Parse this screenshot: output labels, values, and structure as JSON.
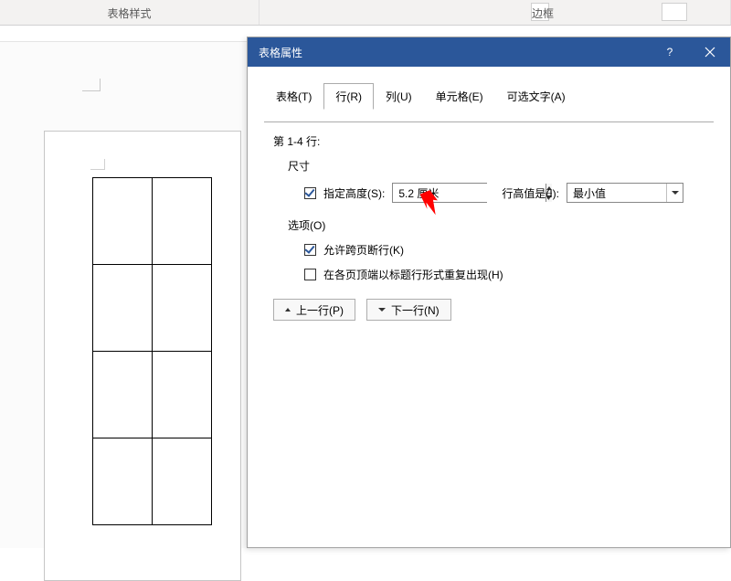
{
  "ribbon": {
    "group_table_styles": "表格样式",
    "group_borders": "边框"
  },
  "dialog": {
    "title": "表格属性",
    "tabs": {
      "table": "表格(T)",
      "row": "行(R)",
      "column": "列(U)",
      "cell": "单元格(E)",
      "alt_text": "可选文字(A)"
    },
    "section_rows": "第 1-4 行:",
    "section_size": "尺寸",
    "specify_height_label": "指定高度(S):",
    "height_value": "5.2 厘米",
    "row_height_is_label": "行高值是(I):",
    "row_height_is_value": "最小值",
    "section_options": "选项(O)",
    "allow_break": "允许跨页断行(K)",
    "repeat_header": "在各页顶端以标题行形式重复出现(H)",
    "prev_row": "上一行(P)",
    "next_row": "下一行(N)"
  }
}
